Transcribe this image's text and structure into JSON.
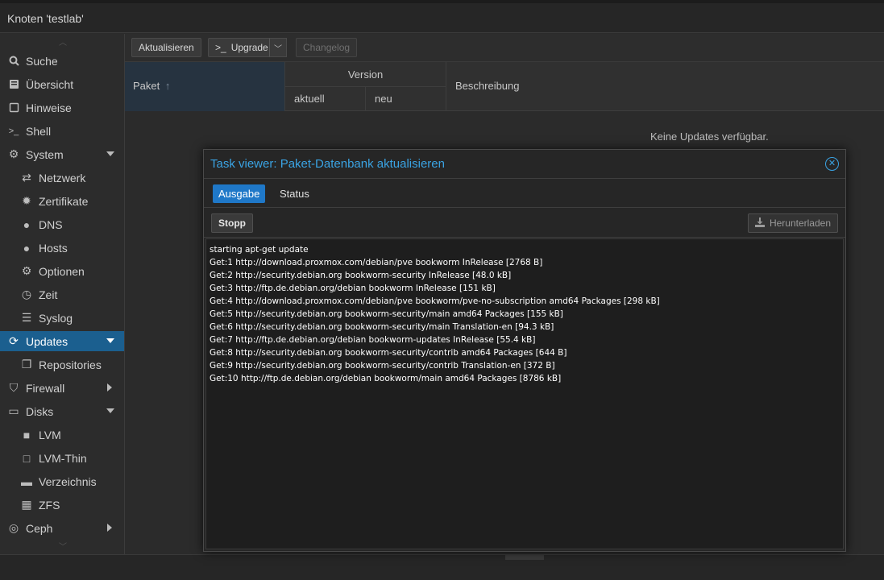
{
  "header": {
    "title": "Knoten 'testlab'"
  },
  "sidebar": {
    "items": [
      {
        "label": "Suche",
        "icon": "search-icon",
        "level": 0
      },
      {
        "label": "Übersicht",
        "icon": "book-icon",
        "level": 0
      },
      {
        "label": "Hinweise",
        "icon": "note-icon",
        "level": 0
      },
      {
        "label": "Shell",
        "icon": "terminal-icon",
        "level": 0
      },
      {
        "label": "System",
        "icon": "gears-icon",
        "level": 0,
        "expand": "down"
      },
      {
        "label": "Netzwerk",
        "icon": "exchange-icon",
        "level": 1
      },
      {
        "label": "Zertifikate",
        "icon": "certificate-icon",
        "level": 1
      },
      {
        "label": "DNS",
        "icon": "globe-icon",
        "level": 1
      },
      {
        "label": "Hosts",
        "icon": "globe-icon",
        "level": 1
      },
      {
        "label": "Optionen",
        "icon": "gear-icon",
        "level": 1
      },
      {
        "label": "Zeit",
        "icon": "clock-icon",
        "level": 1
      },
      {
        "label": "Syslog",
        "icon": "list-icon",
        "level": 1
      },
      {
        "label": "Updates",
        "icon": "refresh-icon",
        "level": 0,
        "expand": "down",
        "active": true
      },
      {
        "label": "Repositories",
        "icon": "files-icon",
        "level": 1
      },
      {
        "label": "Firewall",
        "icon": "shield-icon",
        "level": 0,
        "expand": "right"
      },
      {
        "label": "Disks",
        "icon": "hdd-icon",
        "level": 0,
        "expand": "down"
      },
      {
        "label": "LVM",
        "icon": "square-icon",
        "level": 1
      },
      {
        "label": "LVM-Thin",
        "icon": "square-outline-icon",
        "level": 1
      },
      {
        "label": "Verzeichnis",
        "icon": "folder-icon",
        "level": 1
      },
      {
        "label": "ZFS",
        "icon": "grid-icon",
        "level": 1
      },
      {
        "label": "Ceph",
        "icon": "ceph-icon",
        "level": 0,
        "expand": "right"
      }
    ]
  },
  "toolbar": {
    "refresh_label": "Aktualisieren",
    "upgrade_label": "Upgrade",
    "changelog_label": "Changelog"
  },
  "grid": {
    "col_package": "Paket",
    "col_version": "Version",
    "col_current": "aktuell",
    "col_new": "neu",
    "col_description": "Beschreibung",
    "empty_text": "Keine Updates verfügbar."
  },
  "modal": {
    "title": "Task viewer: Paket-Datenbank aktualisieren",
    "tab_output": "Ausgabe",
    "tab_status": "Status",
    "stop_label": "Stopp",
    "download_label": "Herunterladen",
    "log": [
      "starting apt-get update",
      "Get:1 http://download.proxmox.com/debian/pve bookworm InRelease [2768 B]",
      "Get:2 http://security.debian.org bookworm-security InRelease [48.0 kB]",
      "Get:3 http://ftp.de.debian.org/debian bookworm InRelease [151 kB]",
      "Get:4 http://download.proxmox.com/debian/pve bookworm/pve-no-subscription amd64 Packages [298 kB]",
      "Get:5 http://security.debian.org bookworm-security/main amd64 Packages [155 kB]",
      "Get:6 http://security.debian.org bookworm-security/main Translation-en [94.3 kB]",
      "Get:7 http://ftp.de.debian.org/debian bookworm-updates InRelease [55.4 kB]",
      "Get:8 http://security.debian.org bookworm-security/contrib amd64 Packages [644 B]",
      "Get:9 http://security.debian.org bookworm-security/contrib Translation-en [372 B]",
      "Get:10 http://ftp.de.debian.org/debian bookworm/main amd64 Packages [8786 kB]"
    ]
  },
  "colors": {
    "accent": "#3aa3e3",
    "active_nav": "#1b5f8f",
    "active_tab": "#1f78c8"
  }
}
